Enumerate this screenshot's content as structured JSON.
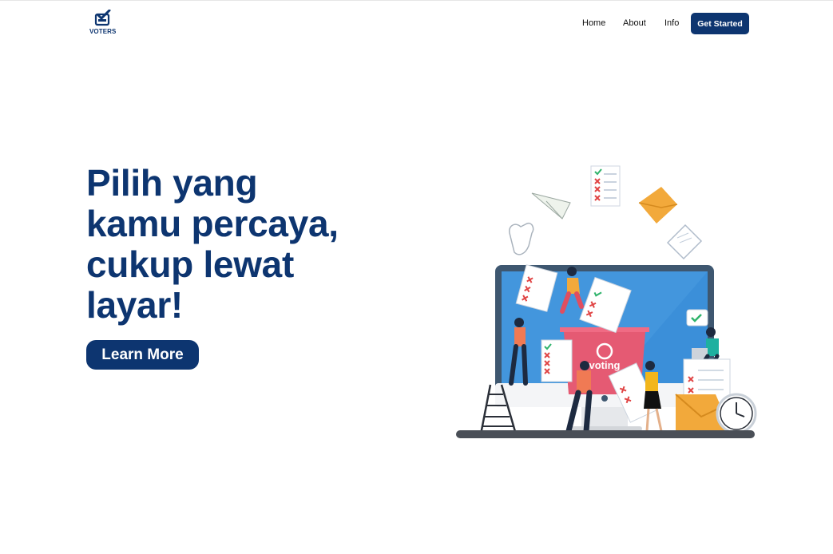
{
  "brand": {
    "name": "VOTERS",
    "icon": "ballot-check-icon"
  },
  "nav": {
    "links": [
      "Home",
      "About",
      "Info"
    ],
    "cta_label": "Get Started"
  },
  "hero": {
    "title_lines": [
      "Pilih yang",
      "kamu percaya,",
      "cukup lewat",
      "layar!"
    ],
    "cta_label": "Learn More"
  },
  "illustration": {
    "ballot_box_label": "voting",
    "icon": "e-voting-illustration"
  },
  "colors": {
    "primary": "#0d3570",
    "screen_blue": "#3b8fd9",
    "ballot_pink": "#e55a73",
    "accent_orange": "#f2a93b",
    "check_green": "#2fb36b",
    "cross_red": "#e04444"
  }
}
